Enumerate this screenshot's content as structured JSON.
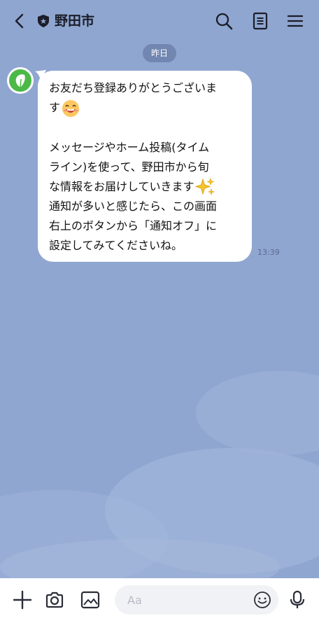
{
  "header": {
    "title": "野田市",
    "back_icon": "chevron-left-icon",
    "shield_icon": "official-badge-icon",
    "search_icon": "search-icon",
    "notes_icon": "notes-icon",
    "menu_icon": "menu-icon"
  },
  "chat": {
    "date_label": "昨日",
    "message": {
      "line1": "お友だち登録ありがとうございま",
      "line2": "す",
      "para2": "メッセージやホーム投稿(タイム\nライン)を使って、野田市から旬\nな情報をお届けしていきます",
      "para3": "通知が多いと感じたら、この画面\n右上のボタンから「通知オフ」に\n設定してみてくださいね。",
      "time": "13:39"
    }
  },
  "composer": {
    "placeholder": "Aa",
    "plus_icon": "plus-icon",
    "camera_icon": "camera-icon",
    "image_icon": "image-icon",
    "emoji_icon": "smiley-icon",
    "mic_icon": "microphone-icon"
  },
  "colors": {
    "background": "#8fa6d0",
    "bubble": "#ffffff",
    "avatar": "#4bb848"
  }
}
